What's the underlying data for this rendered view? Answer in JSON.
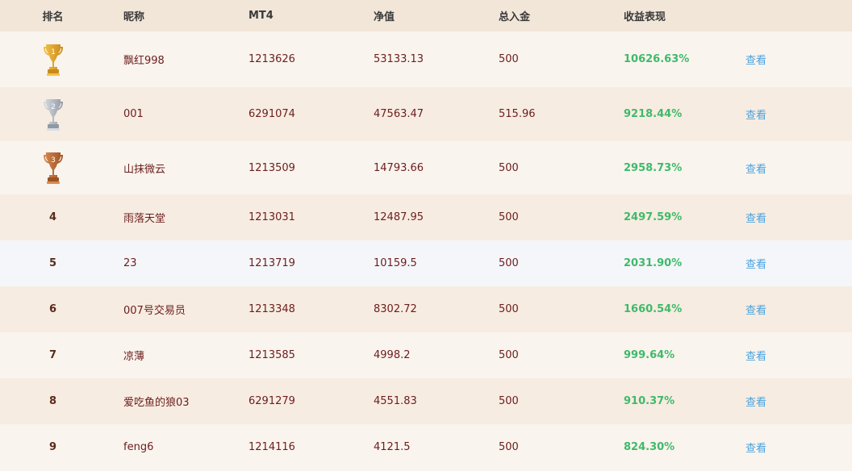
{
  "header": {
    "rank": "排名",
    "nickname": "昵称",
    "mt4": "MT4",
    "equity": "净值",
    "deposit": "总入金",
    "performance": "收益表现"
  },
  "colors": {
    "header_bg": "#f2e6d9",
    "row_a": "#faf4ee",
    "row_b": "#f7ece1",
    "row_highlight": "#f5f6fa",
    "text": "#6b1d1d",
    "return_green": "#3fba6a",
    "link_blue": "#4aa3df",
    "gold": "#e3a82b",
    "silver": "#a9b3bd",
    "bronze": "#c0713a"
  },
  "rows": [
    {
      "rank": "1",
      "trophy": "gold-trophy-icon",
      "nickname": "飘红998",
      "mt4": "1213626",
      "equity": "53133.13",
      "deposit": "500",
      "performance": "10626.63%",
      "view": "查看"
    },
    {
      "rank": "2",
      "trophy": "silver-trophy-icon",
      "nickname": "001",
      "mt4": "6291074",
      "equity": "47563.47",
      "deposit": "515.96",
      "performance": "9218.44%",
      "view": "查看"
    },
    {
      "rank": "3",
      "trophy": "bronze-trophy-icon",
      "nickname": "山抹微云",
      "mt4": "1213509",
      "equity": "14793.66",
      "deposit": "500",
      "performance": "2958.73%",
      "view": "查看"
    },
    {
      "rank": "4",
      "nickname": "雨落天堂",
      "mt4": "1213031",
      "equity": "12487.95",
      "deposit": "500",
      "performance": "2497.59%",
      "view": "查看"
    },
    {
      "rank": "5",
      "nickname": "23",
      "mt4": "1213719",
      "equity": "10159.5",
      "deposit": "500",
      "performance": "2031.90%",
      "view": "查看"
    },
    {
      "rank": "6",
      "nickname": "007号交易员",
      "mt4": "1213348",
      "equity": "8302.72",
      "deposit": "500",
      "performance": "1660.54%",
      "view": "查看"
    },
    {
      "rank": "7",
      "nickname": "凉薄",
      "mt4": "1213585",
      "equity": "4998.2",
      "deposit": "500",
      "performance": "999.64%",
      "view": "查看"
    },
    {
      "rank": "8",
      "nickname": "爱吃鱼的狼03",
      "mt4": "6291279",
      "equity": "4551.83",
      "deposit": "500",
      "performance": "910.37%",
      "view": "查看"
    },
    {
      "rank": "9",
      "nickname": "feng6",
      "mt4": "1214116",
      "equity": "4121.5",
      "deposit": "500",
      "performance": "824.30%",
      "view": "查看"
    }
  ]
}
